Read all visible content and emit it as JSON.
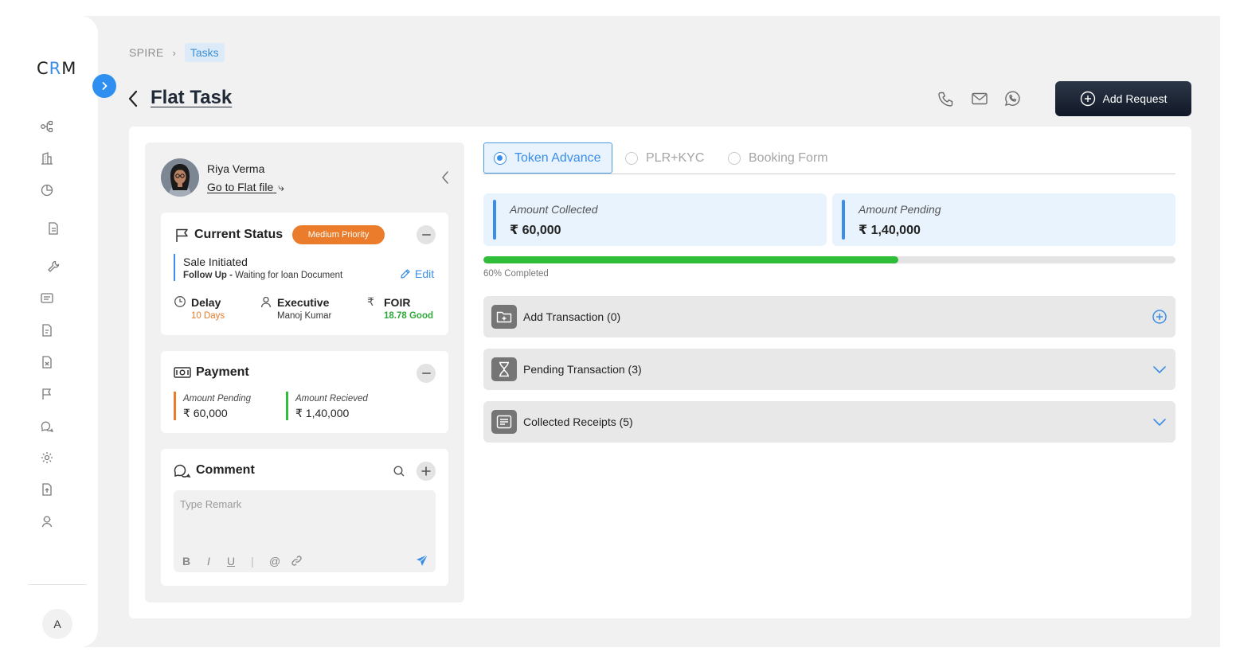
{
  "app": {
    "logo_left": "C",
    "logo_mid": "R",
    "logo_right": "M",
    "avatar_initial": "A"
  },
  "sidebar": {
    "icons": [
      "flow-icon",
      "building-icon",
      "pie-chart-icon",
      "document-icon",
      "wrench-icon",
      "message-box-icon",
      "file-list-icon",
      "file-cancel-icon",
      "flag-icon",
      "chat-icon",
      "settings-icon",
      "upload-file-icon",
      "user-support-icon"
    ]
  },
  "breadcrumb": {
    "root": "SPIRE",
    "separator": "›",
    "current": "Tasks"
  },
  "header": {
    "title": "Flat Task",
    "add_request_label": "Add Request"
  },
  "user": {
    "name": "Riya Verma",
    "link_label": "Go to Flat file"
  },
  "status": {
    "title": "Current Status",
    "priority": "Medium Priority",
    "stage": "Sale Initiated",
    "follow_label": "Follow Up -",
    "follow_text": "Waiting for loan Document",
    "edit_label": "Edit",
    "delay_label": "Delay",
    "delay_value": "10 Days",
    "executive_label": "Executive",
    "executive_value": "Manoj Kumar",
    "foir_label": "FOIR",
    "foir_value": "18.78 Good"
  },
  "payment": {
    "title": "Payment",
    "pending_label": "Amount Pending",
    "pending_value": "₹ 60,000",
    "received_label": "Amount Recieved",
    "received_value": "₹ 1,40,000"
  },
  "comment": {
    "title": "Comment",
    "placeholder": "Type Remark",
    "format_bold": "B",
    "format_italic": "I",
    "format_underline": "U",
    "format_divider": "|",
    "mention": "@"
  },
  "tabs": [
    {
      "label": "Token Advance",
      "selected": true
    },
    {
      "label": "PLR+KYC",
      "selected": false
    },
    {
      "label": "Booking Form",
      "selected": false
    }
  ],
  "amounts": {
    "collected_label": "Amount Collected",
    "collected_value": "₹ 60,000",
    "pending_label": "Amount Pending",
    "pending_value": "₹ 1,40,000"
  },
  "progress": {
    "percent": 60,
    "label": "60% Completed"
  },
  "sections": [
    {
      "label": "Add Transaction (0)",
      "action": "add-circle-icon"
    },
    {
      "label": "Pending Transaction (3)",
      "action": "chevron-down-icon"
    },
    {
      "label": "Collected Receipts (5)",
      "action": "chevron-down-icon"
    }
  ],
  "colors": {
    "accent": "#3b8ee8",
    "priority": "#ea7c2b",
    "success": "#2fbd3a",
    "delay": "#ea7c2b",
    "foir": "#2fa83a",
    "received_bar": "#2fbd3a",
    "pending_bar": "#ea7c2b"
  }
}
